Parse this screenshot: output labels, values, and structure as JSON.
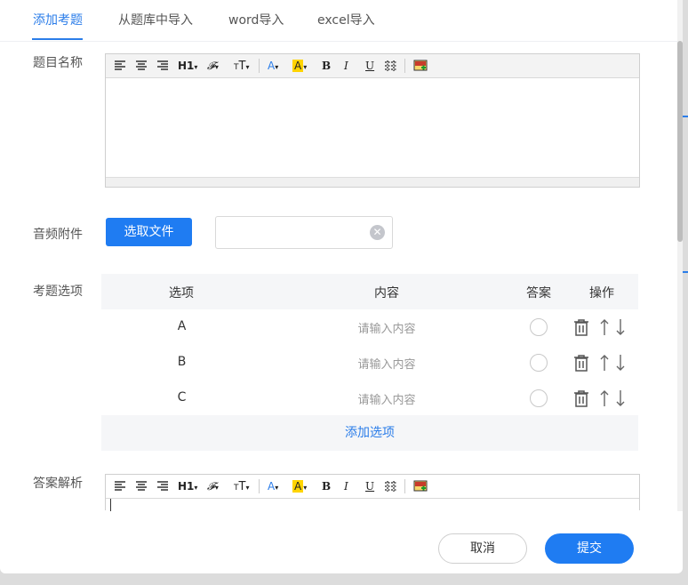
{
  "tabs": [
    {
      "label": "添加考题",
      "active": true
    },
    {
      "label": "从题库中导入",
      "active": false
    },
    {
      "label": "word导入",
      "active": false
    },
    {
      "label": "excel导入",
      "active": false
    }
  ],
  "form": {
    "title_label": "题目名称",
    "audio_label": "音频附件",
    "select_file_label": "选取文件",
    "options_label": "考题选项",
    "analysis_label": "答案解析"
  },
  "editor_toolbar": {
    "heading_label": "H1",
    "font_size_label": "T",
    "bold_label": "B",
    "italic_label": "I",
    "underline_label": "U",
    "icons": [
      "align-left-icon",
      "align-center-icon",
      "align-right-icon",
      "heading-icon",
      "font-family-icon",
      "font-size-icon",
      "font-color-icon",
      "highlight-icon",
      "bold-icon",
      "italic-icon",
      "underline-icon",
      "table-icon",
      "image-icon"
    ]
  },
  "options_table": {
    "headers": {
      "option": "选项",
      "content": "内容",
      "answer": "答案",
      "actions": "操作"
    },
    "rows": [
      {
        "letter": "A",
        "placeholder": "请输入内容"
      },
      {
        "letter": "B",
        "placeholder": "请输入内容"
      },
      {
        "letter": "C",
        "placeholder": "请输入内容"
      }
    ],
    "add_label": "添加选项"
  },
  "footer": {
    "cancel_label": "取消",
    "submit_label": "提交"
  },
  "colors": {
    "accent": "#1f7cf2",
    "tab_active": "#2b7de9"
  }
}
